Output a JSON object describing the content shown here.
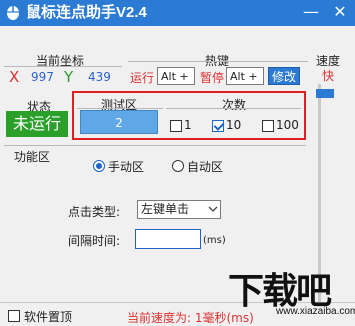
{
  "window": {
    "title": "鼠标连点助手V2.4",
    "minimize_glyph": "—",
    "close_glyph": "✕",
    "title_bar_color": "#2b7ad3"
  },
  "coords": {
    "title": "当前坐标",
    "x_label": "X",
    "x_value": "997",
    "y_label": "Y",
    "y_value": "439"
  },
  "hotkeys": {
    "title": "热键",
    "run_label": "运行",
    "run_value": "Alt +",
    "pause_label": "暂停",
    "pause_value": "Alt +",
    "modify_label": "修改"
  },
  "speed": {
    "title": "速度",
    "value": "快",
    "level": 0.97
  },
  "status": {
    "title": "状态",
    "value": "未运行",
    "color": "#2aa02a"
  },
  "test_area": {
    "title": "测试区",
    "button_label": "2"
  },
  "count": {
    "title": "次数",
    "options": [
      {
        "label": "1",
        "checked": false
      },
      {
        "label": "10",
        "checked": true
      },
      {
        "label": "100",
        "checked": false
      }
    ]
  },
  "function_area": {
    "title": "功能区",
    "manual_label": "手动区",
    "auto_label": "自动区",
    "manual_selected": true,
    "click_type_label": "点击类型:",
    "click_type_value": "左键单击",
    "interval_label": "间隔时间:",
    "interval_value": "",
    "interval_unit": "(ms)"
  },
  "footer": {
    "pin_label": "软件置顶",
    "pin_checked": false,
    "current_speed": "当前速度为: 1毫秒(ms)"
  },
  "watermark": {
    "text": "下载吧",
    "url": "www.xiazaiba.com"
  }
}
